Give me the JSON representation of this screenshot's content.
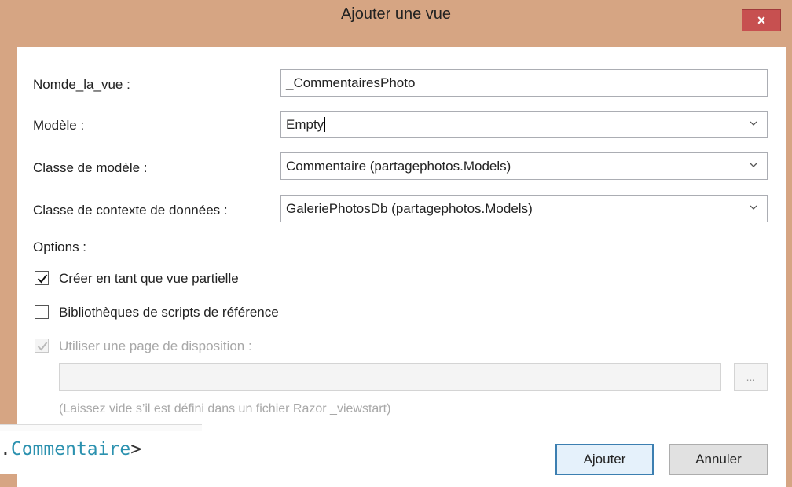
{
  "window": {
    "title": "Ajouter une vue",
    "close_label": "×"
  },
  "form": {
    "view_name_label": "Nomde_la_vue :",
    "view_name_value": "_CommentairesPhoto",
    "template_label": "Modèle :",
    "template_value": "Empty",
    "model_class_label": "Classe de modèle :",
    "model_class_value": "Commentaire (partagephotos.Models)",
    "data_context_label": "Classe de contexte de données :",
    "data_context_value": "GaleriePhotosDb (partagephotos.Models)"
  },
  "options": {
    "heading": "Options :",
    "partial_view_label": "Créer en tant que vue partielle",
    "partial_view_checked": true,
    "script_libs_label": "Bibliothèques de scripts de référence",
    "script_libs_checked": false,
    "layout_page_label": "Utiliser une page de disposition :",
    "layout_page_checked": true,
    "layout_page_enabled": false,
    "layout_path_value": "",
    "browse_label": "...",
    "hint": "(Laissez vide s’il est défini dans un fichier Razor _viewstart)"
  },
  "buttons": {
    "add_label": "Ajouter",
    "cancel_label": "Annuler"
  },
  "overlay": {
    "dot": ".",
    "type_name": "Commentaire",
    "closing": ">"
  },
  "colors": {
    "frame": "#d6a583",
    "close_button": "#c75050",
    "default_button_border": "#3c7fb1",
    "code_type": "#2b91af"
  },
  "icons": {
    "close": "close-icon",
    "checkmark": "checkmark-icon",
    "dropdown": "chevron-down-icon"
  }
}
